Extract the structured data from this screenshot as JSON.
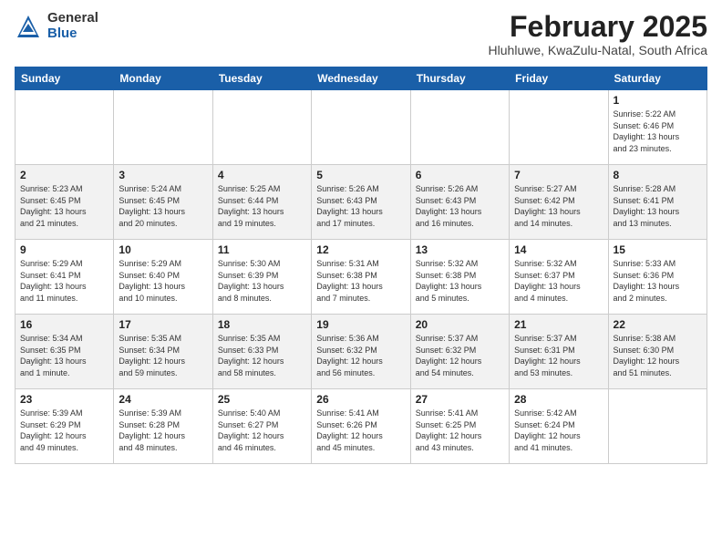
{
  "header": {
    "logo": {
      "general": "General",
      "blue": "Blue"
    },
    "title": "February 2025",
    "location": "Hluhluwe, KwaZulu-Natal, South Africa"
  },
  "weekdays": [
    "Sunday",
    "Monday",
    "Tuesday",
    "Wednesday",
    "Thursday",
    "Friday",
    "Saturday"
  ],
  "weeks": [
    [
      {
        "day": "",
        "info": ""
      },
      {
        "day": "",
        "info": ""
      },
      {
        "day": "",
        "info": ""
      },
      {
        "day": "",
        "info": ""
      },
      {
        "day": "",
        "info": ""
      },
      {
        "day": "",
        "info": ""
      },
      {
        "day": "1",
        "info": "Sunrise: 5:22 AM\nSunset: 6:46 PM\nDaylight: 13 hours\nand 23 minutes."
      }
    ],
    [
      {
        "day": "2",
        "info": "Sunrise: 5:23 AM\nSunset: 6:45 PM\nDaylight: 13 hours\nand 21 minutes."
      },
      {
        "day": "3",
        "info": "Sunrise: 5:24 AM\nSunset: 6:45 PM\nDaylight: 13 hours\nand 20 minutes."
      },
      {
        "day": "4",
        "info": "Sunrise: 5:25 AM\nSunset: 6:44 PM\nDaylight: 13 hours\nand 19 minutes."
      },
      {
        "day": "5",
        "info": "Sunrise: 5:26 AM\nSunset: 6:43 PM\nDaylight: 13 hours\nand 17 minutes."
      },
      {
        "day": "6",
        "info": "Sunrise: 5:26 AM\nSunset: 6:43 PM\nDaylight: 13 hours\nand 16 minutes."
      },
      {
        "day": "7",
        "info": "Sunrise: 5:27 AM\nSunset: 6:42 PM\nDaylight: 13 hours\nand 14 minutes."
      },
      {
        "day": "8",
        "info": "Sunrise: 5:28 AM\nSunset: 6:41 PM\nDaylight: 13 hours\nand 13 minutes."
      }
    ],
    [
      {
        "day": "9",
        "info": "Sunrise: 5:29 AM\nSunset: 6:41 PM\nDaylight: 13 hours\nand 11 minutes."
      },
      {
        "day": "10",
        "info": "Sunrise: 5:29 AM\nSunset: 6:40 PM\nDaylight: 13 hours\nand 10 minutes."
      },
      {
        "day": "11",
        "info": "Sunrise: 5:30 AM\nSunset: 6:39 PM\nDaylight: 13 hours\nand 8 minutes."
      },
      {
        "day": "12",
        "info": "Sunrise: 5:31 AM\nSunset: 6:38 PM\nDaylight: 13 hours\nand 7 minutes."
      },
      {
        "day": "13",
        "info": "Sunrise: 5:32 AM\nSunset: 6:38 PM\nDaylight: 13 hours\nand 5 minutes."
      },
      {
        "day": "14",
        "info": "Sunrise: 5:32 AM\nSunset: 6:37 PM\nDaylight: 13 hours\nand 4 minutes."
      },
      {
        "day": "15",
        "info": "Sunrise: 5:33 AM\nSunset: 6:36 PM\nDaylight: 13 hours\nand 2 minutes."
      }
    ],
    [
      {
        "day": "16",
        "info": "Sunrise: 5:34 AM\nSunset: 6:35 PM\nDaylight: 13 hours\nand 1 minute."
      },
      {
        "day": "17",
        "info": "Sunrise: 5:35 AM\nSunset: 6:34 PM\nDaylight: 12 hours\nand 59 minutes."
      },
      {
        "day": "18",
        "info": "Sunrise: 5:35 AM\nSunset: 6:33 PM\nDaylight: 12 hours\nand 58 minutes."
      },
      {
        "day": "19",
        "info": "Sunrise: 5:36 AM\nSunset: 6:32 PM\nDaylight: 12 hours\nand 56 minutes."
      },
      {
        "day": "20",
        "info": "Sunrise: 5:37 AM\nSunset: 6:32 PM\nDaylight: 12 hours\nand 54 minutes."
      },
      {
        "day": "21",
        "info": "Sunrise: 5:37 AM\nSunset: 6:31 PM\nDaylight: 12 hours\nand 53 minutes."
      },
      {
        "day": "22",
        "info": "Sunrise: 5:38 AM\nSunset: 6:30 PM\nDaylight: 12 hours\nand 51 minutes."
      }
    ],
    [
      {
        "day": "23",
        "info": "Sunrise: 5:39 AM\nSunset: 6:29 PM\nDaylight: 12 hours\nand 49 minutes."
      },
      {
        "day": "24",
        "info": "Sunrise: 5:39 AM\nSunset: 6:28 PM\nDaylight: 12 hours\nand 48 minutes."
      },
      {
        "day": "25",
        "info": "Sunrise: 5:40 AM\nSunset: 6:27 PM\nDaylight: 12 hours\nand 46 minutes."
      },
      {
        "day": "26",
        "info": "Sunrise: 5:41 AM\nSunset: 6:26 PM\nDaylight: 12 hours\nand 45 minutes."
      },
      {
        "day": "27",
        "info": "Sunrise: 5:41 AM\nSunset: 6:25 PM\nDaylight: 12 hours\nand 43 minutes."
      },
      {
        "day": "28",
        "info": "Sunrise: 5:42 AM\nSunset: 6:24 PM\nDaylight: 12 hours\nand 41 minutes."
      },
      {
        "day": "",
        "info": ""
      }
    ]
  ]
}
